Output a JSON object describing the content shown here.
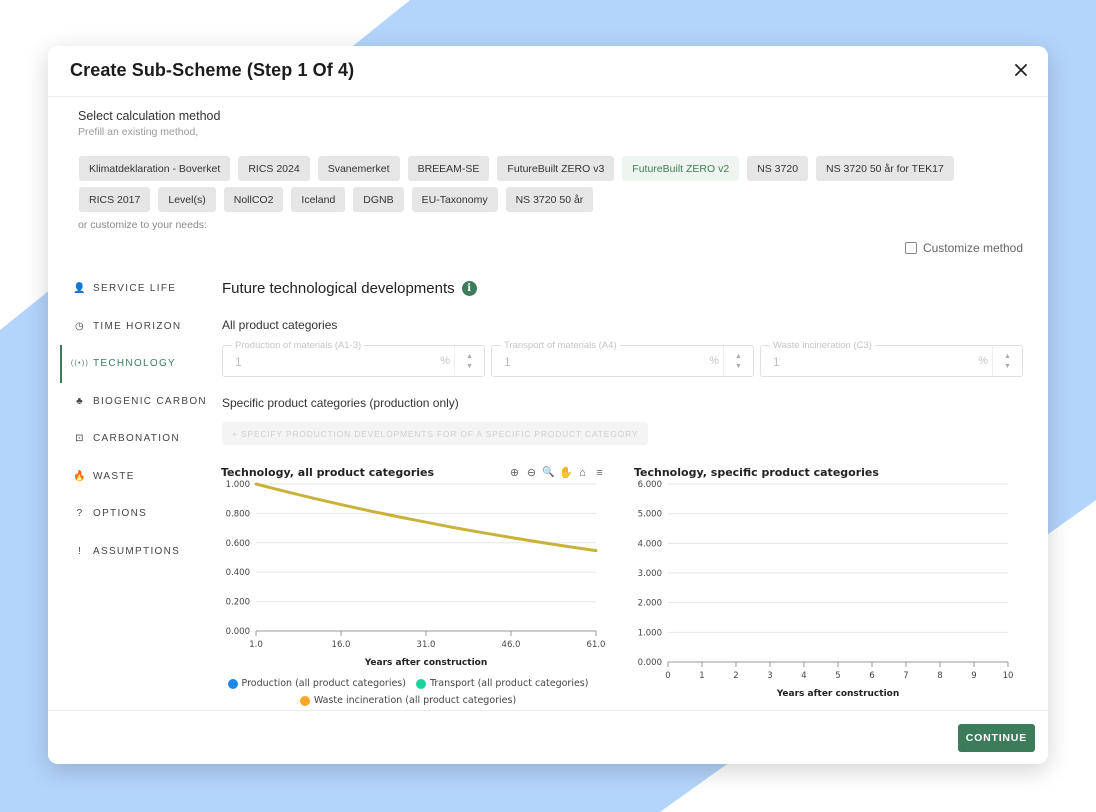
{
  "modal": {
    "title": "Create Sub-Scheme (Step 1 Of 4)",
    "close_icon": "close-icon"
  },
  "method": {
    "label": "Select calculation method",
    "hint": "Prefill an existing method,",
    "row1": [
      "Klimatdeklaration - Boverket",
      "RICS 2024",
      "Svanemerket",
      "BREEAM-SE",
      "FutureBuilt ZERO v3",
      "FutureBuilt ZERO v2",
      "NS 3720",
      "NS 3720 50 år for TEK17"
    ],
    "row2": [
      "RICS 2017",
      "Level(s)",
      "NollCO2",
      "Iceland",
      "DGNB",
      "EU-Taxonomy",
      "NS 3720 50 år"
    ],
    "active": "FutureBuilt ZERO v2",
    "customize_hint": "or customize to your needs:",
    "customize_label": "Customize method",
    "customize_checked": false
  },
  "sidebar": {
    "items": [
      {
        "label": "SERVICE LIFE",
        "icon": "person-icon",
        "glyph": "👤"
      },
      {
        "label": "TIME HORIZON",
        "icon": "clock-icon",
        "glyph": "◷"
      },
      {
        "label": "TECHNOLOGY",
        "icon": "signal-icon",
        "glyph": "((•))"
      },
      {
        "label": "BIOGENIC CARBON",
        "icon": "tree-icon",
        "glyph": "♣"
      },
      {
        "label": "CARBONATION",
        "icon": "box-icon",
        "glyph": "⊡"
      },
      {
        "label": "WASTE",
        "icon": "flame-icon",
        "glyph": "🔥"
      },
      {
        "label": "OPTIONS",
        "icon": "help-icon",
        "glyph": "?"
      },
      {
        "label": "ASSUMPTIONS",
        "icon": "exclamation-icon",
        "glyph": "!"
      }
    ],
    "active_index": 2
  },
  "content": {
    "title": "Future technological developments",
    "info_glyph": "i",
    "all_categories_label": "All product categories",
    "fields": [
      {
        "label": "Production of materials (A1-3)",
        "value": "1",
        "unit": "%"
      },
      {
        "label": "Transport of materials (A4)",
        "value": "1",
        "unit": "%"
      },
      {
        "label": "Waste incineration (C3)",
        "value": "1",
        "unit": "%"
      }
    ],
    "stepper_up": "▲",
    "stepper_down": "▼",
    "specific_label": "Specific product categories (production only)",
    "add_button_label": "+ SPECIFY PRODUCTION DEVELOPMENTS FOR OF A SPECIFIC PRODUCT CATEGORY"
  },
  "charts": {
    "toolbar": [
      {
        "name": "zoom-in-icon",
        "glyph": "⊕"
      },
      {
        "name": "zoom-out-icon",
        "glyph": "⊖"
      },
      {
        "name": "search-zoom-icon",
        "glyph": "🔍"
      },
      {
        "name": "pan-hand-icon",
        "glyph": "✋"
      },
      {
        "name": "home-icon",
        "glyph": "⌂"
      },
      {
        "name": "menu-icon",
        "glyph": "≡"
      }
    ],
    "colors": {
      "line": "#c9b13a",
      "production": "#1e88e5",
      "transport": "#1dd1a1",
      "waste": "#f9a825",
      "grid": "#e6e6e6",
      "axis": "#999999"
    }
  },
  "chart_data": [
    {
      "type": "line",
      "title": "Technology, all product categories",
      "xlabel": "Years after construction",
      "ylabel": "",
      "x_ticks": [
        "1.0",
        "16.0",
        "31.0",
        "46.0",
        "61.0"
      ],
      "y_ticks": [
        "0.000",
        "0.200",
        "0.400",
        "0.600",
        "0.800",
        "1.000"
      ],
      "xlim": [
        1,
        61
      ],
      "ylim": [
        0,
        1
      ],
      "x": [
        1,
        6,
        11,
        16,
        21,
        26,
        31,
        36,
        41,
        46,
        51,
        56,
        61
      ],
      "series": [
        {
          "name": "Production (all product categories)",
          "values": [
            1.0,
            0.951,
            0.904,
            0.86,
            0.818,
            0.778,
            0.74,
            0.703,
            0.669,
            0.636,
            0.605,
            0.575,
            0.547
          ]
        },
        {
          "name": "Transport (all product categories)",
          "values": [
            1.0,
            0.951,
            0.904,
            0.86,
            0.818,
            0.778,
            0.74,
            0.703,
            0.669,
            0.636,
            0.605,
            0.575,
            0.547
          ]
        },
        {
          "name": "Waste incineration (all product categories)",
          "values": [
            1.0,
            0.951,
            0.904,
            0.86,
            0.818,
            0.778,
            0.74,
            0.703,
            0.669,
            0.636,
            0.605,
            0.575,
            0.547
          ]
        }
      ],
      "legend": "bottom",
      "grid": true
    },
    {
      "type": "line",
      "title": "Technology, specific product categories",
      "xlabel": "Years after construction",
      "ylabel": "",
      "x_ticks": [
        "0",
        "1",
        "2",
        "3",
        "4",
        "5",
        "6",
        "7",
        "8",
        "9",
        "10"
      ],
      "y_ticks": [
        "0.000",
        "1.000",
        "2.000",
        "3.000",
        "4.000",
        "5.000",
        "6.000"
      ],
      "xlim": [
        0,
        10
      ],
      "ylim": [
        0,
        6
      ],
      "series": [],
      "grid": true
    }
  ],
  "footer": {
    "continue_label": "CONTINUE"
  }
}
